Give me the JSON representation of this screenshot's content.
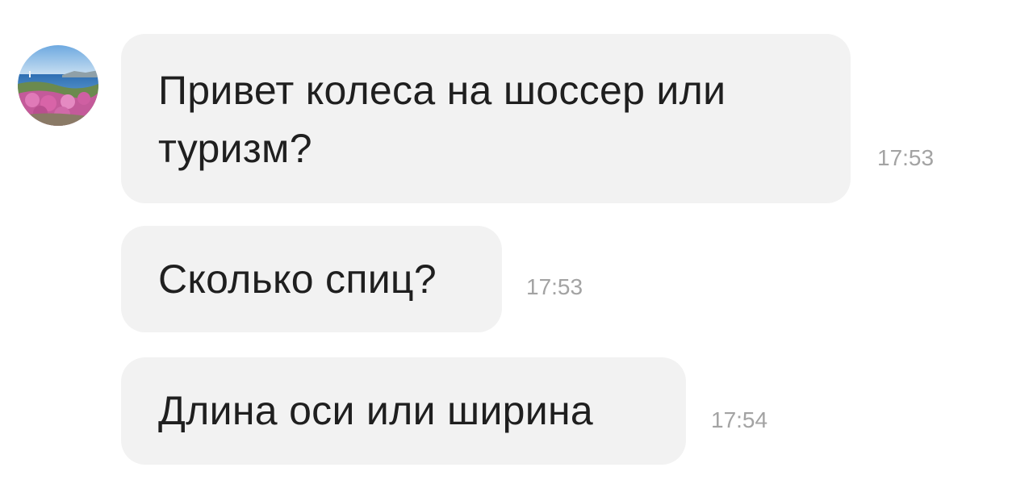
{
  "conversation": {
    "avatar_icon": "landscape-photo-avatar",
    "messages": [
      {
        "text": "Привет колеса на шоссер или\nтуризм?",
        "time": "17:53"
      },
      {
        "text": "Сколько спиц?",
        "time": "17:53"
      },
      {
        "text": "Длина оси или ширина",
        "time": "17:54"
      }
    ]
  },
  "colors": {
    "bubble_background": "#f2f2f2",
    "message_text": "#1f1f1f",
    "timestamp_text": "#a3a3a3",
    "page_background": "#ffffff"
  }
}
